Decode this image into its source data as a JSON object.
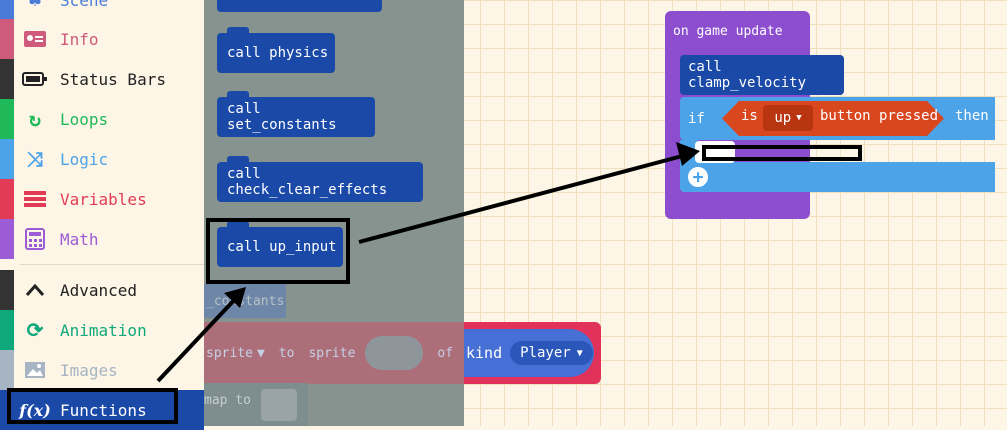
{
  "toolbox": {
    "categories": [
      {
        "label": "Scene",
        "color": "#4b7bd9"
      },
      {
        "label": "Info",
        "color": "#cf5a7c"
      },
      {
        "label": "Status Bars",
        "color": "#333333"
      },
      {
        "label": "Loops",
        "color": "#20b95a"
      },
      {
        "label": "Logic",
        "color": "#4ca3e8"
      },
      {
        "label": "Variables",
        "color": "#e23b55"
      },
      {
        "label": "Math",
        "color": "#9b5cd6"
      },
      {
        "label": "Advanced",
        "color": "#333333"
      },
      {
        "label": "Animation",
        "color": "#0fa87a"
      },
      {
        "label": "Images",
        "color": "#a6b4c4"
      },
      {
        "label": "Functions",
        "color": "#ffffff"
      }
    ]
  },
  "flyout": {
    "blocks": [
      {
        "label": "call physics"
      },
      {
        "label": "call set_constants"
      },
      {
        "label": "call check_clear_effects"
      },
      {
        "label": "call up_input"
      }
    ],
    "partial_labels": {
      "constants": "_constants",
      "set_sprite": "sprite",
      "to": "to",
      "sprite": "sprite",
      "of": "of",
      "map_to": "map to"
    }
  },
  "workspace": {
    "kind_block": {
      "label": "kind",
      "value": "Player"
    },
    "event": {
      "title": "on game update"
    },
    "call_block": {
      "label": "call clamp_velocity"
    },
    "if_block": {
      "if_label": "if",
      "then_label": "then"
    },
    "condition": {
      "is_label": "is",
      "button": "up",
      "rest": "button pressed"
    }
  }
}
